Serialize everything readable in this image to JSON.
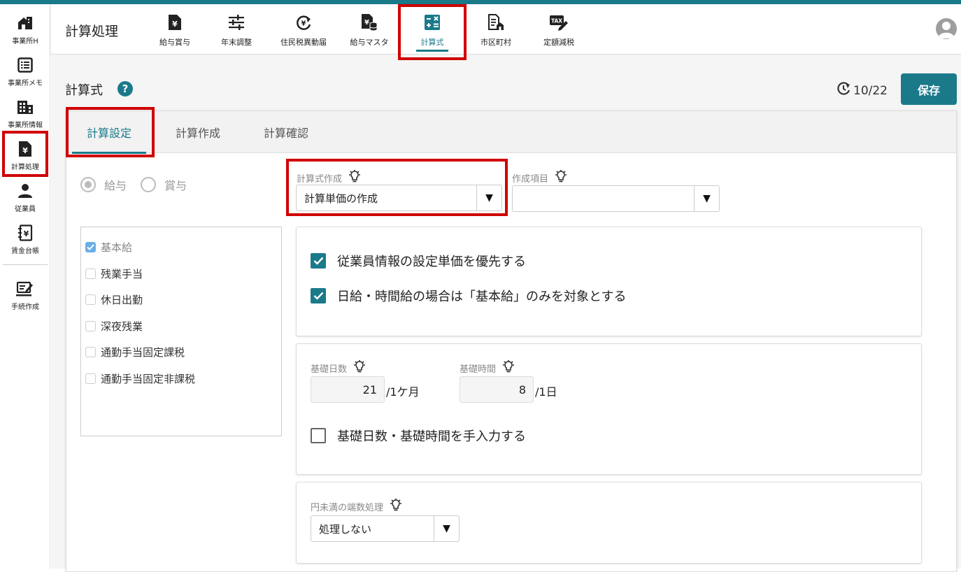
{
  "colors": {
    "accent": "#1a7a8a",
    "highlight": "#d00000"
  },
  "sidebar": {
    "items": [
      {
        "label": "事業所H",
        "icon": "office-home-icon"
      },
      {
        "label": "事業所メモ",
        "icon": "memo-list-icon"
      },
      {
        "label": "事業所情報",
        "icon": "building-icon"
      },
      {
        "label": "計算処理",
        "icon": "yen-document-icon"
      },
      {
        "label": "従業員",
        "icon": "person-icon"
      },
      {
        "label": "賃金台帳",
        "icon": "ledger-yen-icon"
      },
      {
        "label": "手続作成",
        "icon": "form-edit-icon"
      }
    ]
  },
  "header": {
    "title": "計算処理",
    "nav": [
      {
        "label": "給与賞与",
        "icon": "yen-document-icon"
      },
      {
        "label": "年末調整",
        "icon": "sliders-icon"
      },
      {
        "label": "住民税異動届",
        "icon": "refresh-yen-icon"
      },
      {
        "label": "給与マスタ",
        "icon": "yen-database-icon"
      },
      {
        "label": "計算式",
        "icon": "calculator-icon"
      },
      {
        "label": "市区町村",
        "icon": "city-document-icon"
      },
      {
        "label": "定額減税",
        "icon": "tax-edit-icon"
      }
    ]
  },
  "page": {
    "title": "計算式",
    "help": "?",
    "history": "10/22",
    "save": "保存"
  },
  "tabs": [
    "計算設定",
    "計算作成",
    "計算確認"
  ],
  "radios": [
    {
      "label": "給与",
      "selected": true
    },
    {
      "label": "賞与",
      "selected": false
    }
  ],
  "items": [
    {
      "label": "基本給",
      "checked": true
    },
    {
      "label": "残業手当",
      "checked": false
    },
    {
      "label": "休日出勤",
      "checked": false
    },
    {
      "label": "深夜残業",
      "checked": false
    },
    {
      "label": "通勤手当固定課税",
      "checked": false
    },
    {
      "label": "通勤手当固定非課税",
      "checked": false
    }
  ],
  "formula": {
    "label": "計算式作成",
    "value": "計算単価の作成",
    "arrow": "▼"
  },
  "target": {
    "label": "作成項目",
    "value": "",
    "arrow": "▼"
  },
  "options": {
    "prefer_employee_rate": {
      "label": "従業員情報の設定単価を優先する",
      "checked": true
    },
    "daily_hourly_basic_only": {
      "label": "日給・時間給の場合は「基本給」のみを対象とする",
      "checked": true
    }
  },
  "basis": {
    "days_label": "基礎日数",
    "days_value": "21",
    "days_unit": "/1ケ月",
    "hours_label": "基礎時間",
    "hours_value": "8",
    "hours_unit": "/1日",
    "manual": {
      "label": "基礎日数・基礎時間を手入力する",
      "checked": false
    }
  },
  "rounding": {
    "label": "円未満の端数処理",
    "value": "処理しない",
    "arrow": "▼"
  }
}
